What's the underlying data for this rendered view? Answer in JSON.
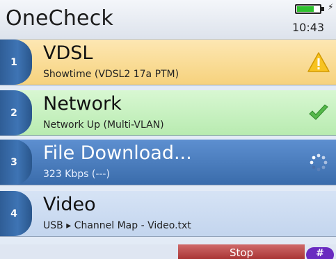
{
  "header": {
    "title": "OneCheck",
    "time": "10:43",
    "battery_level": 0.75,
    "charging": true
  },
  "tests": [
    {
      "number": "1",
      "title": "VDSL",
      "subtitle": "Showtime (VDSL2 17a PTM)",
      "status_icon": "warning-icon",
      "colors": {
        "bg_top": "#fde7b3",
        "bg_bottom": "#f6d27d",
        "text": "#111111",
        "sub": "#222222"
      }
    },
    {
      "number": "2",
      "title": "Network",
      "subtitle": "Network Up (Multi-VLAN)",
      "status_icon": "checkmark-icon",
      "colors": {
        "bg_top": "#d8f7d2",
        "bg_bottom": "#b8ebb0",
        "text": "#111111",
        "sub": "#222222"
      }
    },
    {
      "number": "3",
      "title": "File Download...",
      "subtitle": "323 Kbps (---)",
      "status_icon": "spinner-icon",
      "colors": {
        "bg_top": "#5d8fd0",
        "bg_bottom": "#3a6cab",
        "text": "#ffffff",
        "sub": "#e8f0ff"
      }
    },
    {
      "number": "4",
      "title": "Video",
      "subtitle": "USB ▸ Channel Map - Video.txt",
      "status_icon": "",
      "colors": {
        "bg_top": "#d6e3f5",
        "bg_bottom": "#c3d5ee",
        "text": "#111111",
        "sub": "#222222"
      }
    }
  ],
  "footer": {
    "stop_label": "Stop",
    "hash_label": "#"
  }
}
